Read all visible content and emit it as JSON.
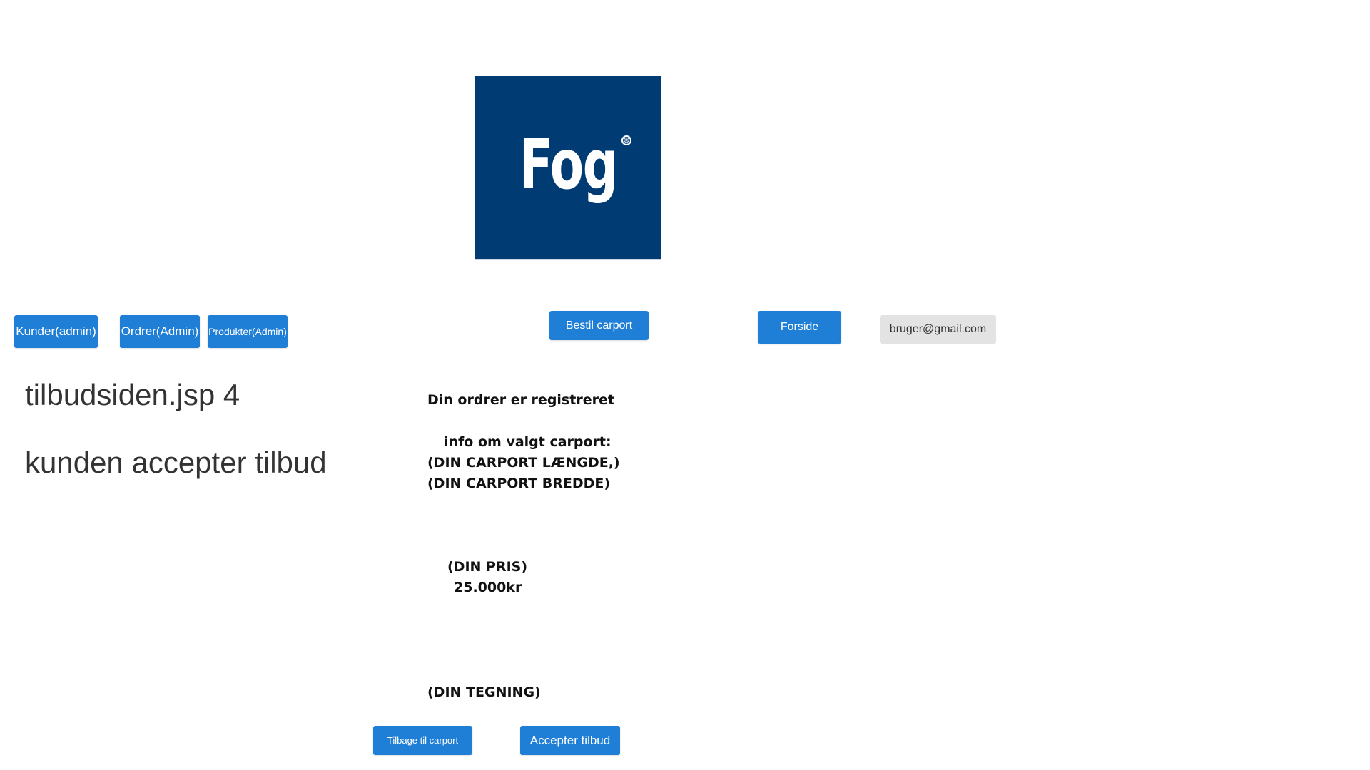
{
  "logo": {
    "text": "Fog",
    "registered_mark": "®",
    "background_color": "#003b73"
  },
  "nav": {
    "kunder_label": "Kunder(admin)",
    "ordrer_label": "Ordrer(Admin)",
    "produkter_label": "Produkter(Admin)",
    "bestil_label": "Bestil carport",
    "forside_label": "Forside",
    "user_email": "bruger@gmail.com",
    "accent_color": "#1f7fd6"
  },
  "left": {
    "title": "tilbudsiden.jsp 4",
    "subtitle": "kunden accepter tilbud"
  },
  "order": {
    "registered": "Din ordrer er registreret",
    "info_title": "info om valgt carport:",
    "length": "(DIN CARPORT LÆNGDE,)",
    "width": "(DIN CARPORT BREDDE)",
    "price_label": "(DIN PRIS)",
    "price_value": "25.000kr",
    "drawing": "(DIN TEGNING)"
  },
  "actions": {
    "back_label": "Tilbage til carport",
    "accept_label": "Accepter tilbud"
  }
}
